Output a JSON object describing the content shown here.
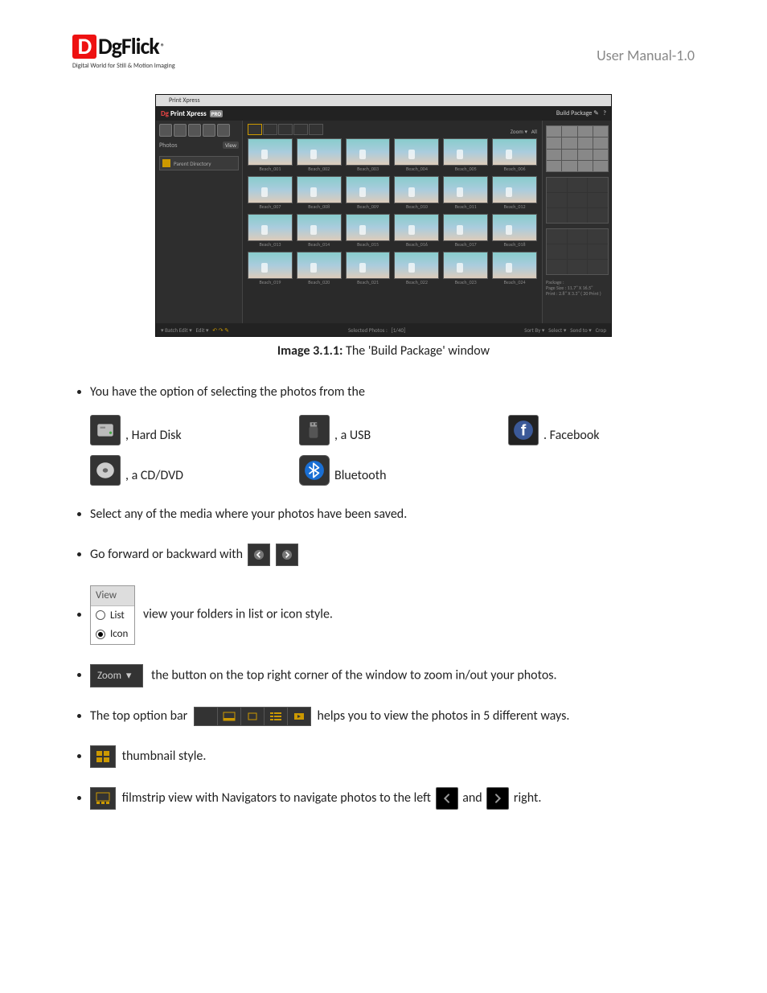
{
  "header": {
    "logo_name": "DgFlick",
    "logo_tagline": "Digital World for Still & Motion Imaging",
    "right": "User Manual-1.0"
  },
  "screenshot": {
    "window_title": "Print Xpress",
    "brand": "Print Xpress",
    "brand_badge": "PRO",
    "build_package": "Build Package",
    "left_label": "Photos",
    "view_btn": "View",
    "parent_dir": "Parent Directory",
    "zoom": "Zoom",
    "all": "All",
    "thumb_prefix": "Beach_0",
    "bottom": {
      "batch": "Batch Edit",
      "edit": "Edit",
      "selected": "Selected Photos :",
      "count": "[1/40]",
      "sort": "Sort By",
      "select": "Select",
      "send": "Send to",
      "crop": "Crop"
    },
    "info": {
      "package": "Package :",
      "page_size": "Page Size : 11.7\" X 16.5\"",
      "print": "Print : 2.8\" X 3.3\" ( 20 Print )"
    }
  },
  "caption_bold": "Image 3.1.1:",
  "caption_rest": " The 'Build Package' window",
  "bullets": {
    "b1": "You have the option of selecting the photos from the",
    "src_hd": ", Hard Disk",
    "src_usb": ", a USB",
    "src_fb": ". Facebook",
    "src_cd": ", a CD/DVD",
    "src_bt": "Bluetooth",
    "b2": "Select any of the media where your photos have been saved.",
    "b3": "Go forward or backward with ",
    "b4_widget_header": "View",
    "b4_list": "List",
    "b4_icon": "Icon",
    "b4": " view your folders in list or icon style.",
    "b5_zoom": "Zoom",
    "b5": " the button on the top right corner of the window to zoom in/out your photos.",
    "b6a": "The top option bar ",
    "b6b": " helps you to view the photos in 5 different ways.",
    "b7": " thumbnail style.",
    "b8a": " filmstrip view with Navigators to navigate photos to the left ",
    "b8b": "  and ",
    "b8c": " right."
  }
}
